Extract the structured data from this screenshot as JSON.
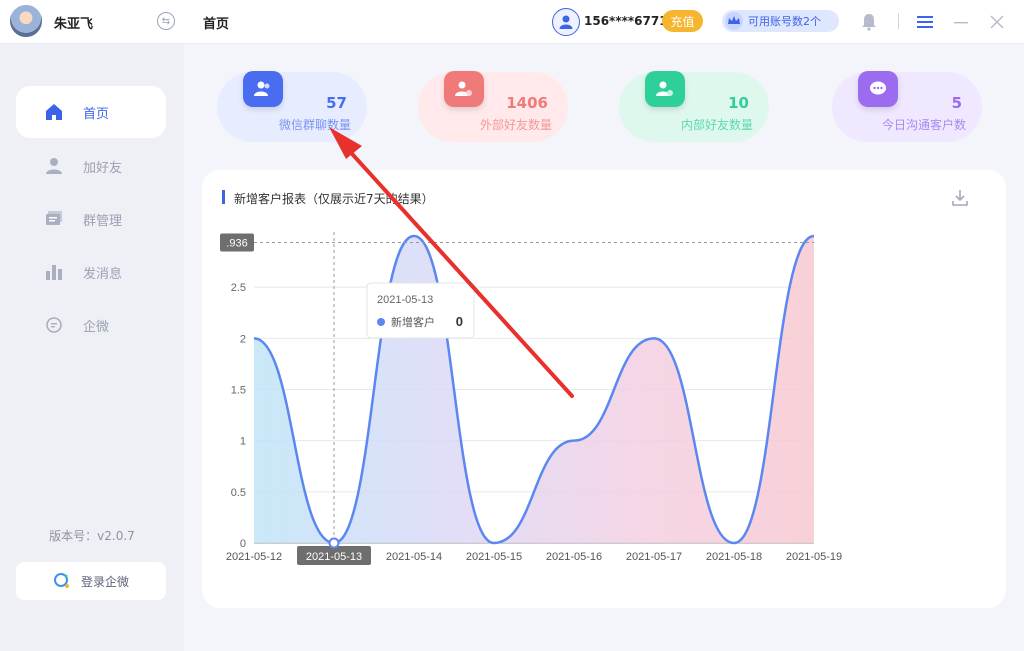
{
  "user": {
    "name": "朱亚飞"
  },
  "nav": [
    {
      "label": "首页",
      "icon": "home-icon",
      "active": true
    },
    {
      "label": "加好友",
      "icon": "user-add-icon",
      "active": false
    },
    {
      "label": "群管理",
      "icon": "group-manage-icon",
      "active": false
    },
    {
      "label": "发消息",
      "icon": "bar-chart-icon",
      "active": false
    },
    {
      "label": "企微",
      "icon": "chat-icon",
      "active": false
    }
  ],
  "version": "版本号：v2.0.7",
  "login_button": "登录企微",
  "header": {
    "title": "首页",
    "phone": "156****6771",
    "recharge": "充值",
    "accounts": "可用账号数2个"
  },
  "stats": [
    {
      "value": "57",
      "label": "微信群聊数量",
      "color": "#4a6cf0"
    },
    {
      "value": "1406",
      "label": "外部好友数量",
      "color": "#f07a7a"
    },
    {
      "value": "10",
      "label": "内部好友数量",
      "color": "#2fcf9c"
    },
    {
      "value": "5",
      "label": "今日沟通客户数",
      "color": "#9b6cf0"
    }
  ],
  "chart_title": "新增客户报表（仅展示近7天的结果）",
  "chart_data": {
    "type": "area",
    "x": [
      "2021-05-12",
      "2021-05-13",
      "2021-05-14",
      "2021-05-15",
      "2021-05-16",
      "2021-05-17",
      "2021-05-18",
      "2021-05-19"
    ],
    "series": [
      {
        "name": "新增客户",
        "values": [
          2,
          0,
          3,
          0,
          1,
          2,
          0,
          3
        ]
      }
    ],
    "yticks": [
      "0",
      "0.5",
      "1",
      "1.5",
      "2",
      "2.5"
    ],
    "ylim": [
      0,
      3
    ],
    "grid": true,
    "crosshair": {
      "x_label": "2021-05-13",
      "y_label": ".936",
      "y_value": 2.936
    },
    "tooltip": {
      "date": "2021-05-13",
      "series": "新增客户",
      "value": "0"
    },
    "line_color": "#5b87f0"
  }
}
